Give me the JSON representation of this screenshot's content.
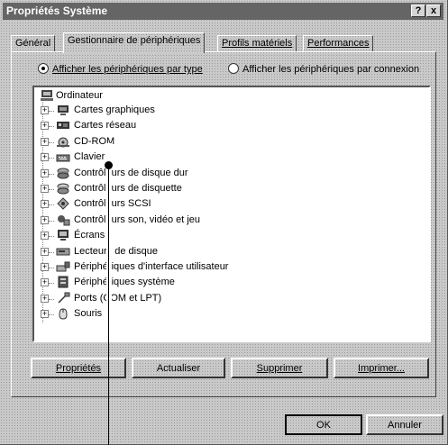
{
  "window": {
    "title": "Propriétés Système",
    "help_label": "?",
    "close_label": "x"
  },
  "tabs": [
    {
      "label": "Général"
    },
    {
      "label": "Gestionnaire de périphériques"
    },
    {
      "label": "Profils matériels"
    },
    {
      "label": "Performances"
    }
  ],
  "view": {
    "by_type_label": "Afficher les périphériques par type",
    "by_connection_label": "Afficher les périphériques par connexion",
    "selected": "by_type"
  },
  "tree": {
    "root": "Ordinateur",
    "items": [
      {
        "label": "Cartes graphiques",
        "icon": "display-adapter-icon"
      },
      {
        "label": "Cartes réseau",
        "icon": "network-card-icon"
      },
      {
        "label": "CD-ROM",
        "icon": "cdrom-icon"
      },
      {
        "label": "Clavier",
        "icon": "keyboard-icon"
      },
      {
        "label": "Contrôleurs de disque dur",
        "icon": "hard-disk-controller-icon"
      },
      {
        "label": "Contrôleurs de disquette",
        "icon": "floppy-controller-icon"
      },
      {
        "label": "Contrôleurs SCSI",
        "icon": "scsi-controller-icon"
      },
      {
        "label": "Contrôleurs son, vidéo et jeu",
        "icon": "sound-video-game-icon"
      },
      {
        "label": "Écrans",
        "icon": "monitor-icon"
      },
      {
        "label": "Lecteurs de disque",
        "icon": "disk-drive-icon"
      },
      {
        "label": "Périphériques d'interface utilisateur",
        "icon": "hid-icon"
      },
      {
        "label": "Périphériques système",
        "icon": "system-device-icon"
      },
      {
        "label": "Ports (COM et LPT)",
        "icon": "port-icon"
      },
      {
        "label": "Souris",
        "icon": "mouse-icon"
      }
    ]
  },
  "buttons": {
    "properties": "Propriétés",
    "refresh": "Actualiser",
    "remove": "Supprimer",
    "print": "Imprimer...",
    "ok": "OK",
    "cancel": "Annuler"
  }
}
